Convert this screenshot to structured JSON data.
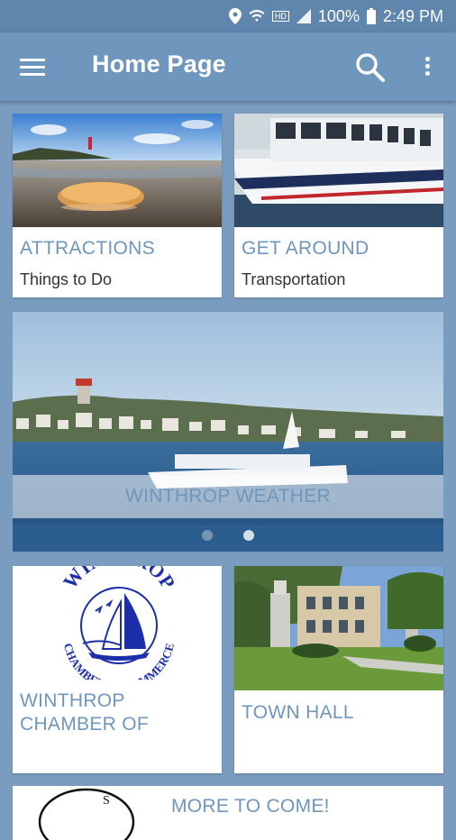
{
  "status": {
    "battery": "100%",
    "time": "2:49 PM",
    "network_label": "HD"
  },
  "appbar": {
    "title": "Home Page"
  },
  "cards": [
    {
      "title": "ATTRACTIONS",
      "subtitle": "Things to Do"
    },
    {
      "title": "GET AROUND",
      "subtitle": "Transportation"
    },
    {
      "title": "WINTHROP CHAMBER OF",
      "subtitle": ""
    },
    {
      "title": "TOWN HALL",
      "subtitle": ""
    },
    {
      "title": "MORE TO COME!",
      "subtitle": ""
    }
  ],
  "banner": {
    "caption": "WINTHROP WEATHER",
    "page_count": 2,
    "active_page": 2
  },
  "chamber_logo": {
    "top_text": "WINTHROP",
    "bottom_text": "CHAMBER OF COMMERCE"
  },
  "colors": {
    "accent": "#6f96bd",
    "background": "#7a9cbf",
    "statusbar": "#5f86ad"
  }
}
